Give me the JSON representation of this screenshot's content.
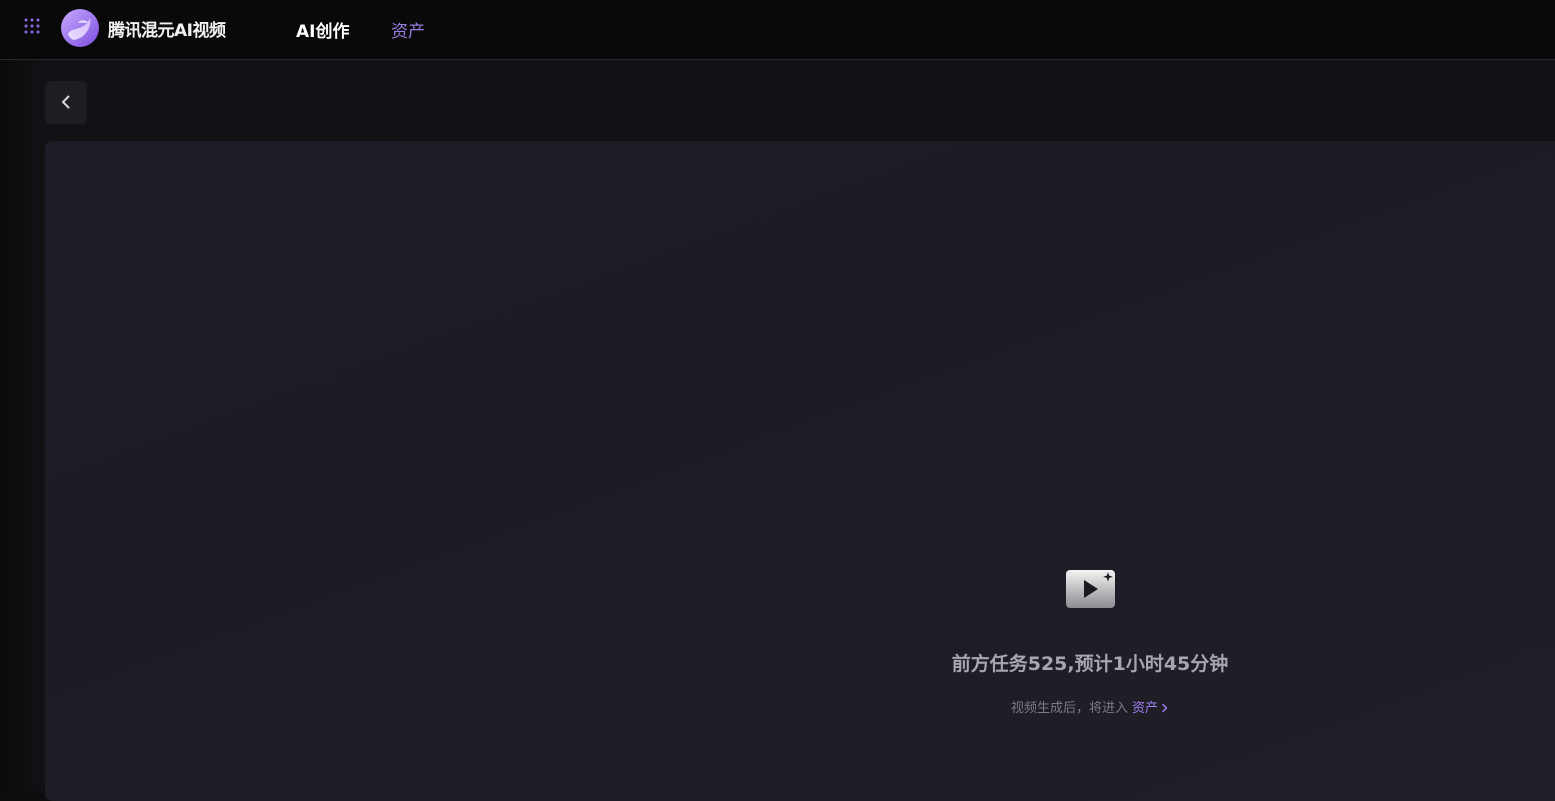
{
  "header": {
    "brand_name": "腾讯混元AI视频",
    "tabs": [
      {
        "label": "AI创作",
        "active": true
      },
      {
        "label": "资产",
        "active": false
      }
    ]
  },
  "status": {
    "queue_message": "前方任务525,预计1小时45分钟",
    "hint_text": "视频生成后，将进入",
    "hint_link": "资产"
  },
  "colors": {
    "accent": "#9b7be0",
    "background": "#121116",
    "panel": "#1e1c26"
  },
  "icons": [
    "apps-grid-icon",
    "brand-logo",
    "chevron-left-icon",
    "video-sparkle-icon",
    "chevron-right-icon"
  ]
}
